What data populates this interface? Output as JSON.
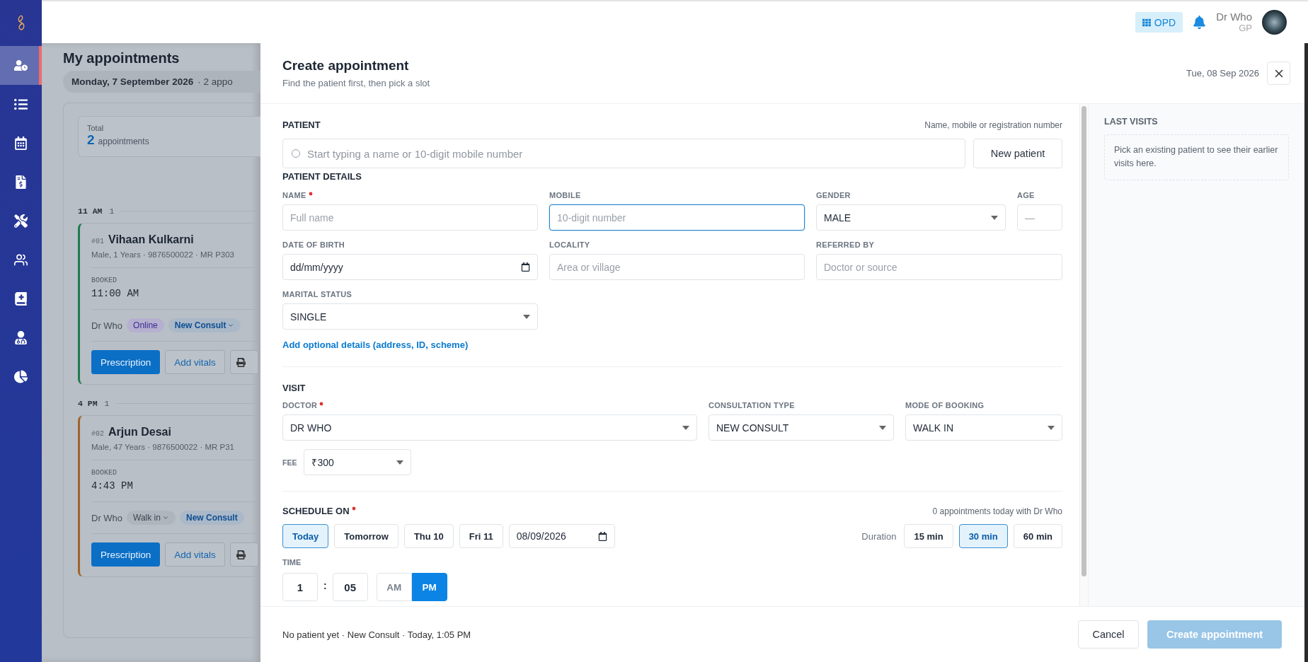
{
  "sidebar": {
    "items": [
      {
        "selected": true
      },
      {
        "selected": false
      },
      {
        "selected": false
      },
      {
        "selected": false
      },
      {
        "selected": false
      },
      {
        "selected": false
      },
      {
        "selected": false
      },
      {
        "selected": false
      },
      {
        "selected": false
      }
    ]
  },
  "header": {
    "module_button": "OPD",
    "user_name": "Dr Who",
    "user_role": "GP"
  },
  "appointments_page": {
    "title": "My appointments",
    "date": "Monday, 7 September 2026",
    "count": "· 2 appo",
    "stat": {
      "label": "Total",
      "value": "2",
      "unit": "appointments"
    },
    "groups": [
      {
        "hour": "11 AM",
        "count": "1",
        "appointments": [
          {
            "number": "#01",
            "name": "Vihaan Kulkarni",
            "details": "Male, 1 Years · 9876500022 · MR P303",
            "status_label": "BOOKED",
            "time": "11:00 AM",
            "doctor": "Dr Who",
            "color": "#1e7a4e",
            "tags": [
              {
                "label": "Online",
                "kind": "badge"
              },
              {
                "label": "New Consult",
                "kind": "type-select"
              }
            ],
            "actions": [
              "Prescription",
              "Add vitals"
            ]
          }
        ]
      },
      {
        "hour": "4 PM",
        "count": "1",
        "appointments": [
          {
            "number": "#02",
            "name": "Arjun Desai",
            "details": "Male, 47 Years · 9876500022 · MR P31",
            "status_label": "BOOKED",
            "time": "4:43 PM",
            "doctor": "Dr Who",
            "color": "#a0652a",
            "tags": [
              {
                "label": "Walk in",
                "kind": "select"
              },
              {
                "label": "New Consult",
                "kind": "type"
              }
            ],
            "actions": [
              "Prescription",
              "Add vitals"
            ]
          }
        ]
      }
    ]
  },
  "modal": {
    "title": "Create appointment",
    "subtitle": "Find the patient first, then pick a slot",
    "date": "Tue, 08 Sep 2026",
    "patient": {
      "heading": "PATIENT",
      "hint": "Name, mobile or registration number",
      "search_placeholder": "Start typing a name or 10-digit mobile number",
      "new_button": "New patient"
    },
    "details": {
      "heading": "PATIENT DETAILS",
      "rows": [
        [
          {
            "label": "NAME",
            "required": true,
            "kind": "text",
            "placeholder": "Full name",
            "focused": false
          },
          {
            "label": "MOBILE",
            "required": false,
            "kind": "text",
            "placeholder": "10-digit number",
            "focused": true
          },
          {
            "label": "GENDER",
            "required": false,
            "kind": "select",
            "value": "MALE",
            "focused": false
          },
          {
            "label": "AGE",
            "required": false,
            "kind": "text",
            "placeholder": "—",
            "focused": false
          }
        ],
        [
          {
            "label": "DATE OF BIRTH",
            "required": false,
            "kind": "date",
            "value": "dd/mm/yyyy",
            "focused": false
          },
          {
            "label": "LOCALITY",
            "required": false,
            "kind": "text",
            "placeholder": "Area or village",
            "focused": false
          },
          {
            "label": "REFERRED BY",
            "required": false,
            "kind": "text",
            "placeholder": "Doctor or source",
            "focused": false
          }
        ],
        [
          {
            "label": "MARITAL STATUS",
            "required": false,
            "kind": "select",
            "value": "SINGLE",
            "focused": false
          }
        ]
      ],
      "optional_link": "Add optional details (address, ID, scheme)"
    },
    "visit": {
      "heading": "VISIT",
      "fields": [
        {
          "label": "DOCTOR",
          "required": true,
          "value": "DR WHO"
        },
        {
          "label": "CONSULTATION TYPE",
          "required": false,
          "value": "NEW CONSULT"
        },
        {
          "label": "MODE OF BOOKING",
          "required": false,
          "value": "WALK IN"
        }
      ],
      "fee": {
        "label": "FEE",
        "value": "₹300"
      }
    },
    "schedule": {
      "heading": "SCHEDULE ON",
      "required": true,
      "note": "0 appointments today with Dr Who",
      "days": [
        {
          "label": "Today",
          "selected": true
        },
        {
          "label": "Tomorrow",
          "selected": false
        },
        {
          "label": "Thu 10",
          "selected": false
        },
        {
          "label": "Fri 11",
          "selected": false
        }
      ],
      "date": "08/09/2026",
      "duration_label": "Duration",
      "durations": [
        {
          "label": "15 min",
          "selected": false
        },
        {
          "label": "30 min",
          "selected": true
        },
        {
          "label": "60 min",
          "selected": false
        }
      ],
      "time_label": "TIME",
      "hour": "1",
      "separator": ":",
      "minute": "05",
      "periods": [
        {
          "label": "AM",
          "selected": false
        },
        {
          "label": "PM",
          "selected": true
        }
      ]
    },
    "last_visits": {
      "heading": "LAST VISITS",
      "empty_text": "Pick an existing patient to see their earlier visits here."
    },
    "footer": {
      "summary": "No patient yet · New Consult · Today, 1:05 PM",
      "cancel": "Cancel",
      "submit": {
        "label": "Create appointment",
        "disabled": true
      }
    }
  }
}
